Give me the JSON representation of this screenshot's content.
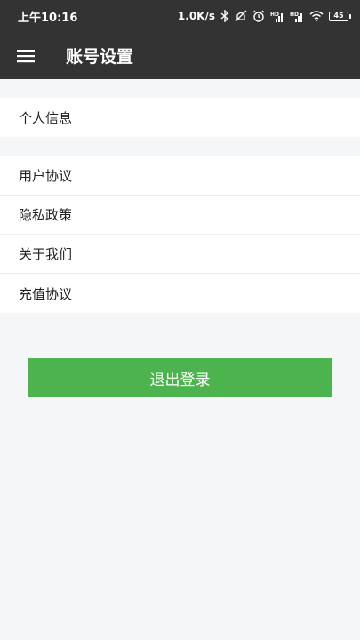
{
  "status_bar": {
    "time": "上午10:16",
    "net_speed": "1.0K/s",
    "battery_level": "45",
    "icons": [
      "bluetooth-icon",
      "mute-icon",
      "alarm-icon",
      "signal-hd-icon",
      "signal-hd-icon",
      "wifi-icon",
      "battery-icon"
    ]
  },
  "app_bar": {
    "title": "账号设置",
    "menu_icon": "hamburger-menu-icon"
  },
  "groups": [
    {
      "items": [
        {
          "label": "个人信息"
        }
      ]
    },
    {
      "items": [
        {
          "label": "用户协议"
        },
        {
          "label": "隐私政策"
        },
        {
          "label": "关于我们"
        },
        {
          "label": "充值协议"
        }
      ]
    }
  ],
  "logout_button": {
    "label": "退出登录"
  },
  "colors": {
    "header_bg": "#333333",
    "page_bg": "#f5f6f8",
    "accent": "#4cb34f"
  }
}
